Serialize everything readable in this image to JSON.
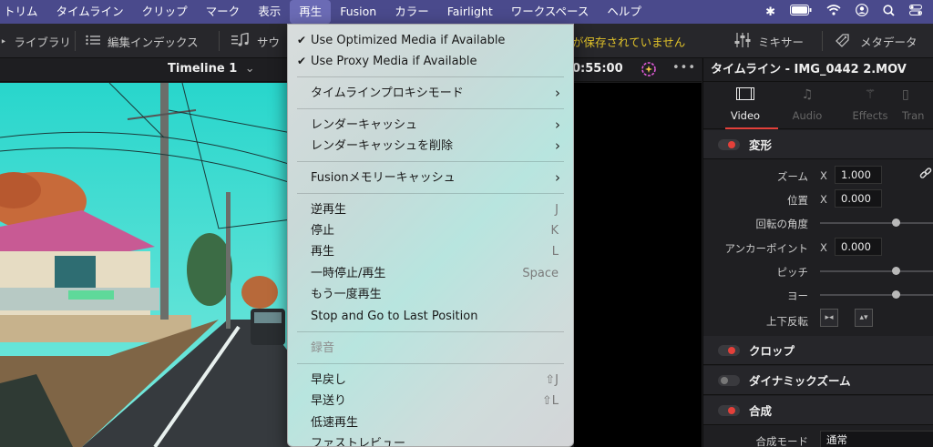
{
  "menubar": {
    "items": [
      "トリム",
      "タイムライン",
      "クリップ",
      "マーク",
      "表示",
      "再生",
      "Fusion",
      "カラー",
      "Fairlight",
      "ワークスペース",
      "ヘルプ"
    ],
    "active_index": 5
  },
  "toolbar": {
    "media_library": "ライブラリ",
    "edit_index": "編集インデックス",
    "sound": "サウ",
    "unsaved_warning": "が保存されていません",
    "mixer": "ミキサー",
    "metadata": "メタデータ"
  },
  "viewer": {
    "timeline_name": "Timeline 1",
    "timecode": "0:55:00"
  },
  "inspector": {
    "header": "タイムライン - IMG_0442 2.MOV",
    "tabs": [
      {
        "label": "Video",
        "active": true
      },
      {
        "label": "Audio",
        "active": false
      },
      {
        "label": "Effects",
        "active": false
      },
      {
        "label": "Tran",
        "active": false
      }
    ],
    "transform": {
      "title": "変形",
      "zoom_label": "ズーム",
      "zoom_axis": "X",
      "zoom_value": "1.000",
      "position_label": "位置",
      "position_axis": "X",
      "position_value": "0.000",
      "rotation_label": "回転の角度",
      "anchor_label": "アンカーポイント",
      "anchor_axis": "X",
      "anchor_value": "0.000",
      "pitch_label": "ピッチ",
      "yaw_label": "ヨー",
      "flip_label": "上下反転"
    },
    "crop": {
      "title": "クロップ"
    },
    "dynamic_zoom": {
      "title": "ダイナミックズーム"
    },
    "composite": {
      "title": "合成",
      "mode_label": "合成モード",
      "mode_value": "通常"
    }
  },
  "playback_menu": {
    "optimized_media": "Use Optimized Media if Available",
    "proxy_media": "Use Proxy Media if Available",
    "timeline_proxy": "タイムラインプロキシモード",
    "render_cache": "レンダーキャッシュ",
    "delete_render_cache": "レンダーキャッシュを削除",
    "fusion_memory_cache": "Fusionメモリーキャッシュ",
    "reverse": "逆再生",
    "reverse_key": "J",
    "stop": "停止",
    "stop_key": "K",
    "play": "再生",
    "play_key": "L",
    "pause": "一時停止/再生",
    "pause_key": "Space",
    "play_again": "もう一度再生",
    "stop_and_go": "Stop and Go to Last Position",
    "record": "録音",
    "rewind": "早戻し",
    "rewind_key": "⇧J",
    "fast_forward": "早送り",
    "fast_forward_key": "⇧L",
    "slow_play": "低速再生",
    "fast_review": "ファストレビュー"
  },
  "colors": {
    "menubar": "#4a4a8c",
    "accent_red": "#e3403a",
    "warning_yellow": "#e0c22a"
  }
}
